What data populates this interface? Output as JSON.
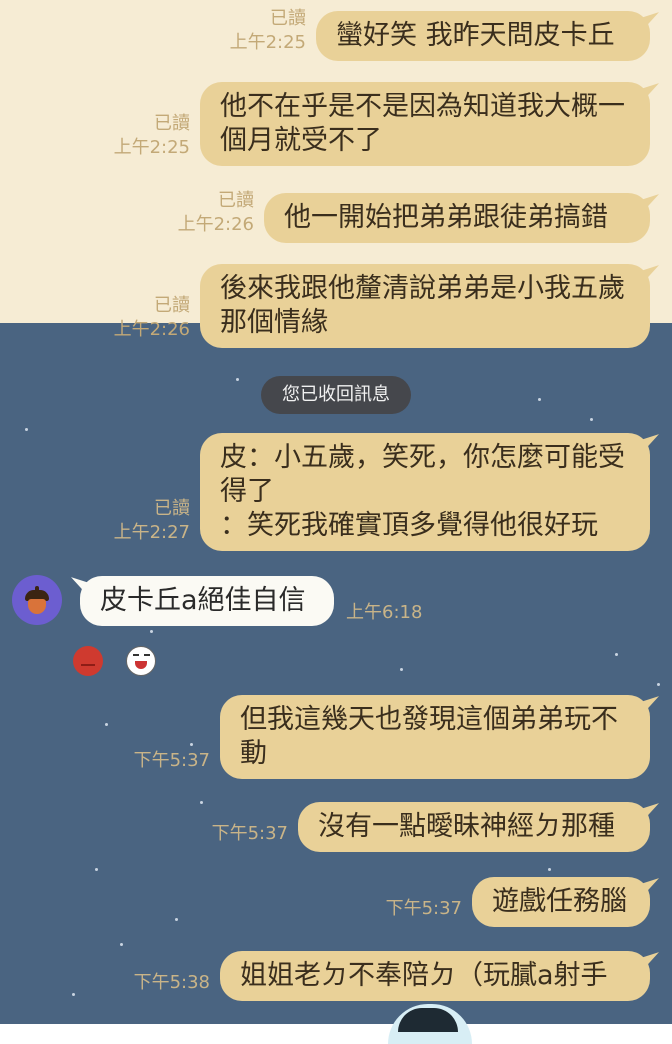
{
  "messages": [
    {
      "text": "蠻好笑 我昨天問皮卡丘",
      "read": "已讀",
      "time": "上午2:25"
    },
    {
      "text": "他不在乎是不是因為知道我大概一個月就受不了",
      "read": "已讀",
      "time": "上午2:25"
    },
    {
      "text": "他一開始把弟弟跟徒弟搞錯",
      "read": "已讀",
      "time": "上午2:26"
    },
    {
      "text": "後來我跟他釐清說弟弟是小我五歲那個情緣",
      "read": "已讀",
      "time": "上午2:26"
    },
    {
      "text": "皮：小五歲，笑死，你怎麼可能受得了\n：笑死我確實頂多覺得他很好玩",
      "read": "已讀",
      "time": "上午2:27"
    },
    {
      "text": "但我這幾天也發現這個弟弟玩不動",
      "read": "",
      "time": "下午5:37"
    },
    {
      "text": "沒有一點曖昧神經ㄉ那種",
      "read": "",
      "time": "下午5:37"
    },
    {
      "text": "遊戲任務腦",
      "read": "",
      "time": "下午5:37"
    },
    {
      "text": "姐姐老ㄉ不奉陪ㄉ（玩膩a射手",
      "read": "",
      "time": "下午5:38"
    }
  ],
  "system_notice": "您已收回訊息",
  "incoming": {
    "text": "皮卡丘a絕佳自信",
    "time": "上午6:18",
    "avatar_icon": "acorn-icon"
  },
  "reactions": [
    "angry-face-icon",
    "laughing-face-icon"
  ],
  "colors": {
    "top_bg": "#f6ecd4",
    "bottom_bg": "#4a6481",
    "bubble_out": "#e9d198",
    "bubble_in": "#fbfaf4"
  }
}
